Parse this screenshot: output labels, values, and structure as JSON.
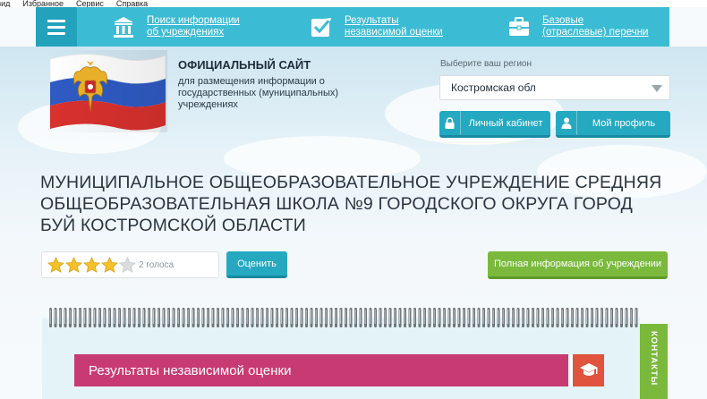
{
  "browser_menu": [
    "зид",
    "Избранное",
    "Сервис",
    "Справка"
  ],
  "nav": {
    "items": [
      {
        "line1": "Поиск информации",
        "line2": "об учреждениях",
        "icon": "building-icon"
      },
      {
        "line1": "Результаты",
        "line2": "независимой оценки",
        "icon": "checkbox-icon"
      },
      {
        "line1": "Базовые",
        "line2": "(отраслевые) перечни",
        "icon": "briefcase-icon"
      }
    ]
  },
  "header": {
    "site_title": "ОФИЦИАЛЬНЫЙ САЙТ",
    "site_subtitle": "для размещения информации о государственных (муниципальных) учреждениях",
    "region_label": "Выберите ваш регион",
    "region_value": "Костромская обл",
    "cabinet_button": "Личный кабинет",
    "profile_button": "Мой профиль"
  },
  "organization": {
    "title": "МУНИЦИПАЛЬНОЕ ОБЩЕОБРАЗОВАТЕЛЬНОЕ УЧРЕЖДЕНИЕ СРЕДНЯЯ ОБЩЕОБРАЗОВАТЕЛЬНАЯ ШКОЛА №9 ГОРОДСКОГО ОКРУГА ГОРОД БУЙ КОСТРОМСКОЙ ОБЛАСТИ",
    "rating_stars": 4,
    "rating_max": 5,
    "votes": "2 голоса",
    "rate_button": "Оценить",
    "full_info_button": "Полная информация об учреждении"
  },
  "notebook": {
    "section_title": "Результаты независимой оценки",
    "contacts_tab": "КОНТАКТЫ"
  },
  "colors": {
    "nav": "#3cbcd4",
    "primary_button": "#24a9c1",
    "green_button": "#7ab93c",
    "result_bar": "#c83a72",
    "star": "#f5c12a"
  }
}
